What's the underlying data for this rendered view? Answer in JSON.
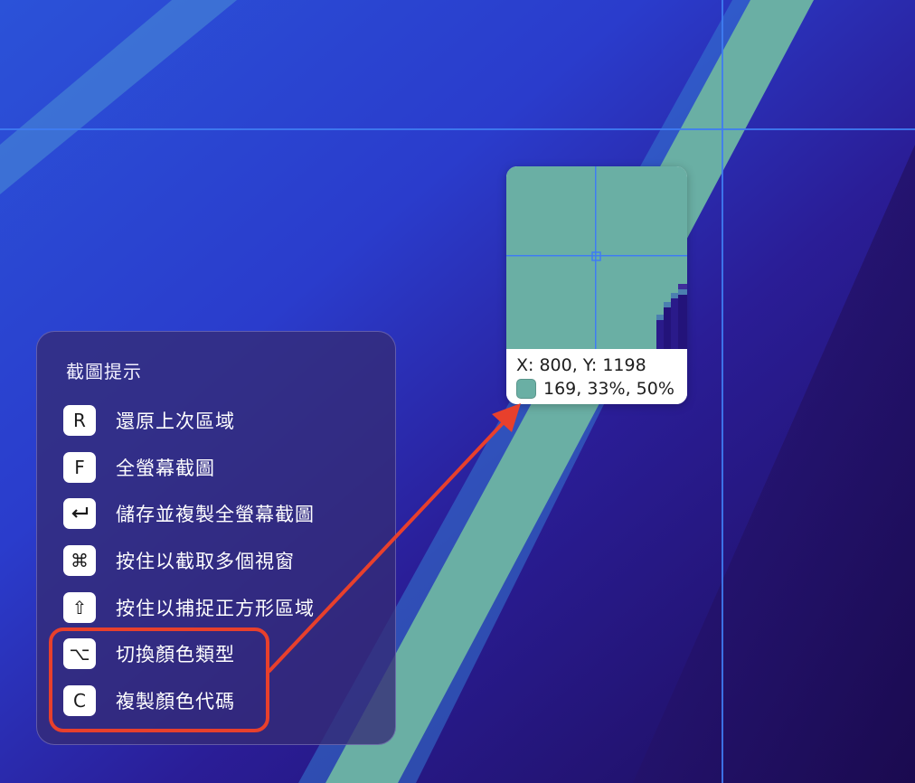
{
  "hint_panel": {
    "title": "截圖提示",
    "items": [
      {
        "key": "R",
        "icon": "",
        "label": "還原上次區域"
      },
      {
        "key": "F",
        "icon": "",
        "label": "全螢幕截圖"
      },
      {
        "key": "",
        "icon": "return-key-icon",
        "label": "儲存並複製全螢幕截圖"
      },
      {
        "key": "⌘",
        "icon": "command-key-icon",
        "label": "按住以截取多個視窗"
      },
      {
        "key": "⇧",
        "icon": "shift-key-icon",
        "label": "按住以捕捉正方形區域"
      },
      {
        "key": "⌥",
        "icon": "option-key-icon",
        "label": "切換顏色類型"
      },
      {
        "key": "C",
        "icon": "",
        "label": "複製顏色代碼"
      }
    ]
  },
  "magnifier": {
    "coordinates": "X: 800, Y: 1198",
    "color_value": "169, 33%, 50%",
    "swatch_color": "#6aafa4"
  },
  "colors": {
    "annotation_red": "#e8402c",
    "guide_blue": "#3f7cf2",
    "teal_stripe": "#6aafa4"
  }
}
